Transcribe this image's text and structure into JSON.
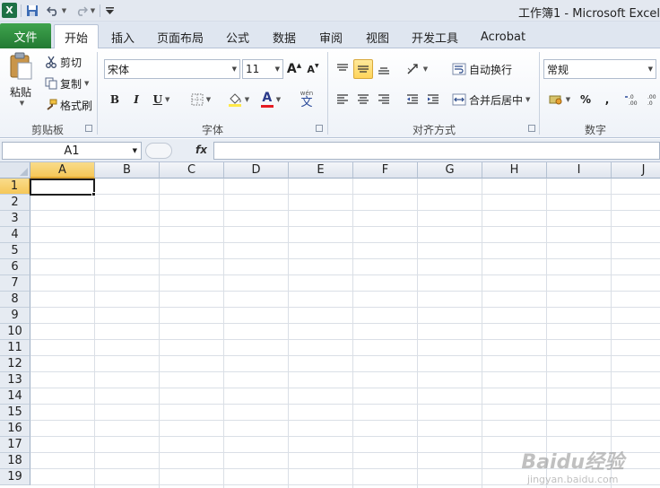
{
  "window": {
    "title": "工作簿1  -  Microsoft Excel"
  },
  "quick_access": {
    "logo": "X"
  },
  "tabs": {
    "file": "文件",
    "items": [
      "开始",
      "插入",
      "页面布局",
      "公式",
      "数据",
      "审阅",
      "视图",
      "开发工具",
      "Acrobat"
    ],
    "active_index": 0
  },
  "ribbon": {
    "clipboard": {
      "label": "剪贴板",
      "paste": "粘贴",
      "cut": "剪切",
      "copy": "复制",
      "format_painter": "格式刷"
    },
    "font": {
      "label": "字体",
      "font_name": "宋体",
      "font_size": "11",
      "bold": "B",
      "italic": "I",
      "underline": "U",
      "grow": "A",
      "shrink": "A",
      "font_color_glyph": "A",
      "wen_glyph": "文",
      "wen_top": "wén",
      "fill_color": "#ffe94a",
      "font_color": "#e51c23"
    },
    "alignment": {
      "label": "对齐方式",
      "wrap_text": "自动换行",
      "merge_center": "合并后居中"
    },
    "number": {
      "label": "数字",
      "format": "常规",
      "percent": "%",
      "comma": ",",
      "inc_decimal": ".0 .00",
      "dec_decimal": ".00 .0"
    }
  },
  "formula_bar": {
    "name_box": "A1",
    "fx": "fx",
    "formula": ""
  },
  "sheet": {
    "columns": [
      "A",
      "B",
      "C",
      "D",
      "E",
      "F",
      "G",
      "H",
      "I",
      "J"
    ],
    "rows": [
      "1",
      "2",
      "3",
      "4",
      "5",
      "6",
      "7",
      "8",
      "9",
      "10",
      "11",
      "12",
      "13",
      "14",
      "15",
      "16",
      "17",
      "18",
      "19"
    ],
    "active_cell": "A1"
  },
  "watermark": {
    "main": "Baidu经验",
    "sub": "jingyan.baidu.com"
  }
}
